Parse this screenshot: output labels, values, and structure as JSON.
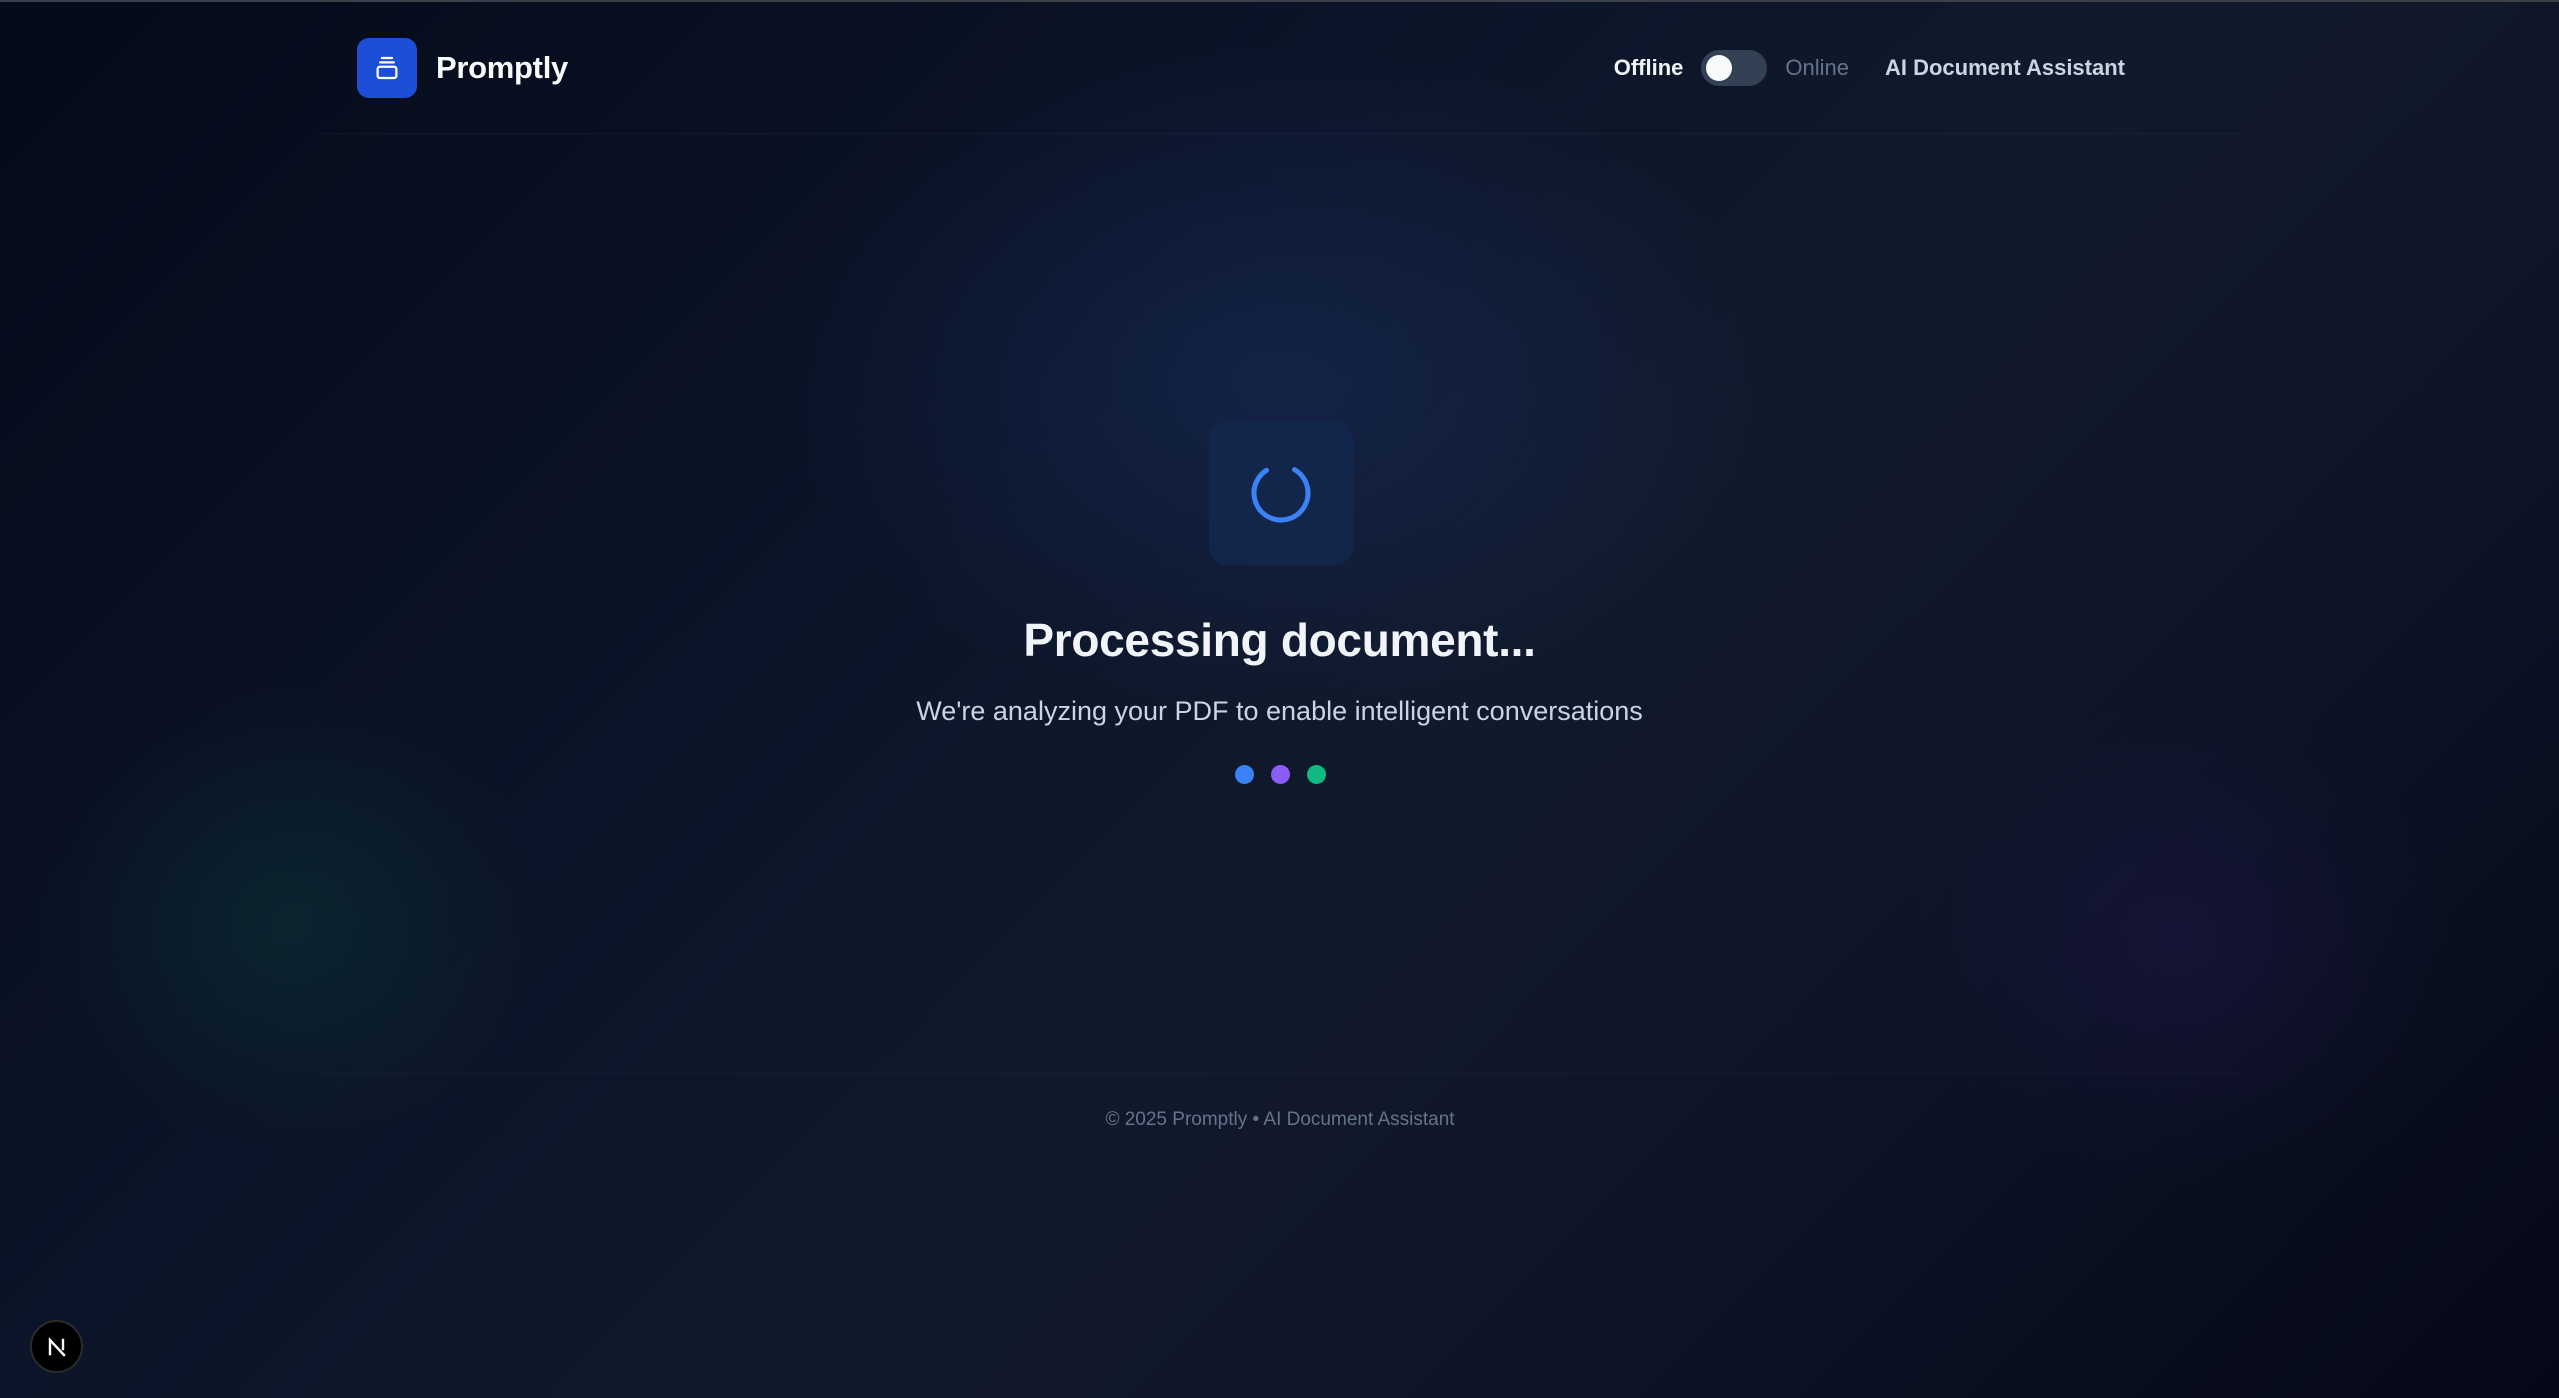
{
  "header": {
    "brand_name": "Promptly",
    "logo_icon": "document-stack-icon",
    "mode_offline_label": "Offline",
    "mode_online_label": "Online",
    "mode_toggle_online": false,
    "tagline": "AI Document Assistant"
  },
  "main": {
    "loader_icon": "spinner-icon",
    "title": "Processing document...",
    "subtitle": "We're analyzing your PDF to enable intelligent conversations",
    "dots": [
      {
        "name": "blue-dot",
        "color": "#3b82f6"
      },
      {
        "name": "purple-dot",
        "color": "#8b5cf6"
      },
      {
        "name": "green-dot",
        "color": "#10b981"
      }
    ]
  },
  "footer": {
    "text": "© 2025 Promptly • AI Document Assistant"
  },
  "dev_badge": {
    "icon": "nextjs-icon",
    "letter": "N"
  },
  "colors": {
    "accent": "#1d4ed8",
    "spinner": "#3b82f6",
    "background": "#0a1122"
  }
}
